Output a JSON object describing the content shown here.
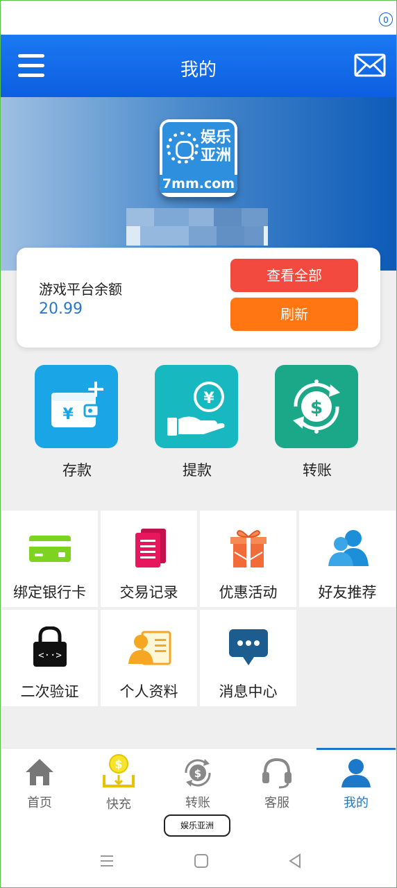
{
  "header": {
    "title": "我的",
    "mail_badge": "0"
  },
  "logo": {
    "line1": "娱乐",
    "line2": "亚洲",
    "url": "7mm.com"
  },
  "balance": {
    "label": "游戏平台余额",
    "value": "20.99",
    "view_all_label": "查看全部",
    "refresh_label": "刷新"
  },
  "actions": [
    {
      "label": "存款",
      "icon": "wallet-plus-icon",
      "color": "#1aa6e6"
    },
    {
      "label": "提款",
      "icon": "hand-coin-icon",
      "color": "#18b8c0"
    },
    {
      "label": "转账",
      "icon": "dollar-cycle-icon",
      "color": "#1aa888"
    }
  ],
  "grid": [
    {
      "label": "绑定银行卡",
      "icon": "bank-card-icon"
    },
    {
      "label": "交易记录",
      "icon": "records-icon"
    },
    {
      "label": "优惠活动",
      "icon": "gift-icon"
    },
    {
      "label": "好友推荐",
      "icon": "friends-icon"
    },
    {
      "label": "二次验证",
      "icon": "lock-code-icon"
    },
    {
      "label": "个人资料",
      "icon": "profile-card-icon"
    },
    {
      "label": "消息中心",
      "icon": "chat-bubble-icon"
    }
  ],
  "tabbar": [
    {
      "label": "首页",
      "icon": "home-icon"
    },
    {
      "label": "快充",
      "icon": "quick-charge-icon"
    },
    {
      "label": "转账",
      "icon": "transfer-icon"
    },
    {
      "label": "客服",
      "icon": "headset-icon"
    },
    {
      "label": "我的",
      "icon": "user-icon",
      "active": true
    }
  ],
  "brand_pill": "娱乐亚洲",
  "colors": {
    "primary": "#0c5fe0",
    "red_button": "#f24a3f",
    "orange_button": "#ff7612",
    "active_tab": "#1c78c9"
  }
}
